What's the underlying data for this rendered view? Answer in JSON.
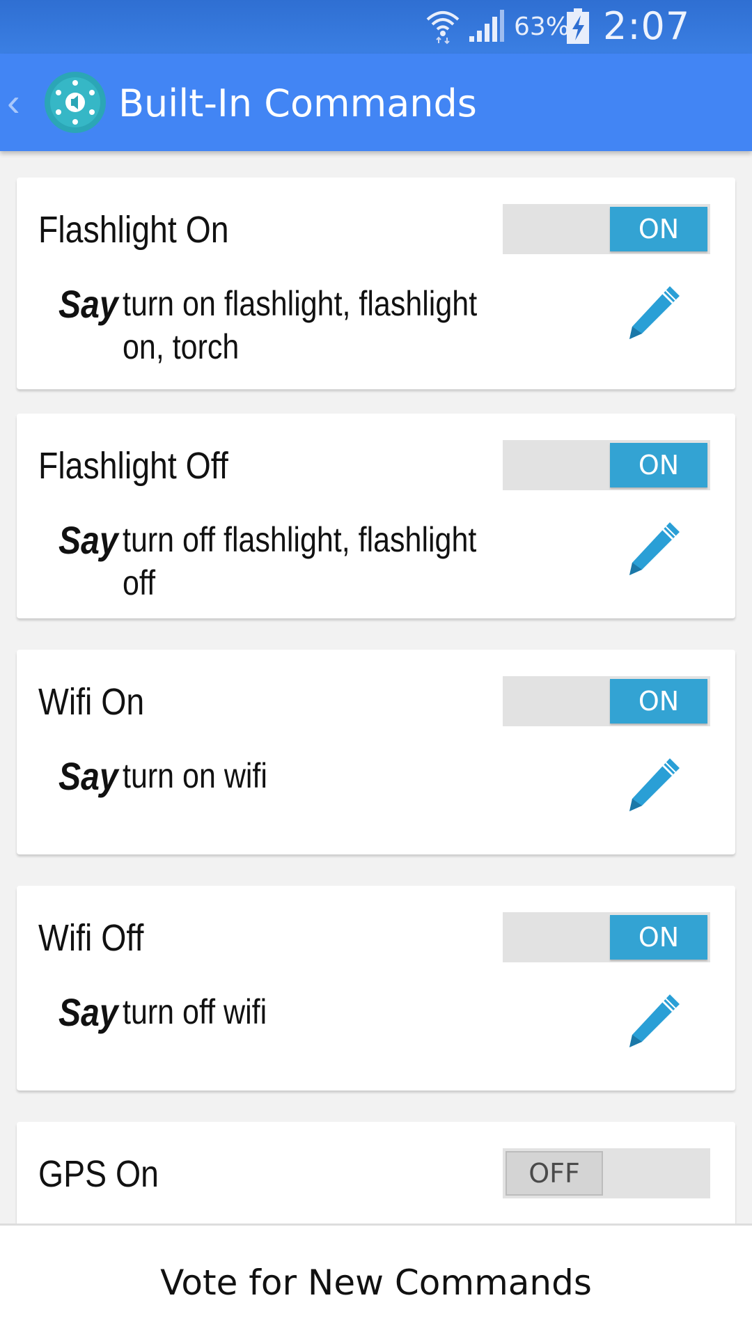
{
  "status_bar": {
    "battery_percent": "63%",
    "time": "2:07 PM",
    "icons": [
      "wifi-icon",
      "signal-icon",
      "battery-charging-icon"
    ]
  },
  "app_bar": {
    "back_glyph": "‹",
    "title": "Built-In Commands"
  },
  "say_label": "Say",
  "commands": [
    {
      "title": "Flashlight On",
      "toggle": "ON",
      "phrases": "turn on flashlight, flashlight on, torch"
    },
    {
      "title": "Flashlight Off",
      "toggle": "ON",
      "phrases": "turn off flashlight, flashlight off"
    },
    {
      "title": "Wifi On",
      "toggle": "ON",
      "phrases": "turn on wifi"
    },
    {
      "title": "Wifi Off",
      "toggle": "ON",
      "phrases": "turn off wifi"
    },
    {
      "title": "GPS On",
      "toggle": "OFF",
      "phrases": ""
    }
  ],
  "bottom": {
    "vote_label": "Vote for New Commands"
  },
  "colors": {
    "status_bar": "#2f6fd2",
    "app_bar": "#4285f4",
    "toggle_on": "#33a3d3",
    "pencil": "#2a9fd6"
  }
}
